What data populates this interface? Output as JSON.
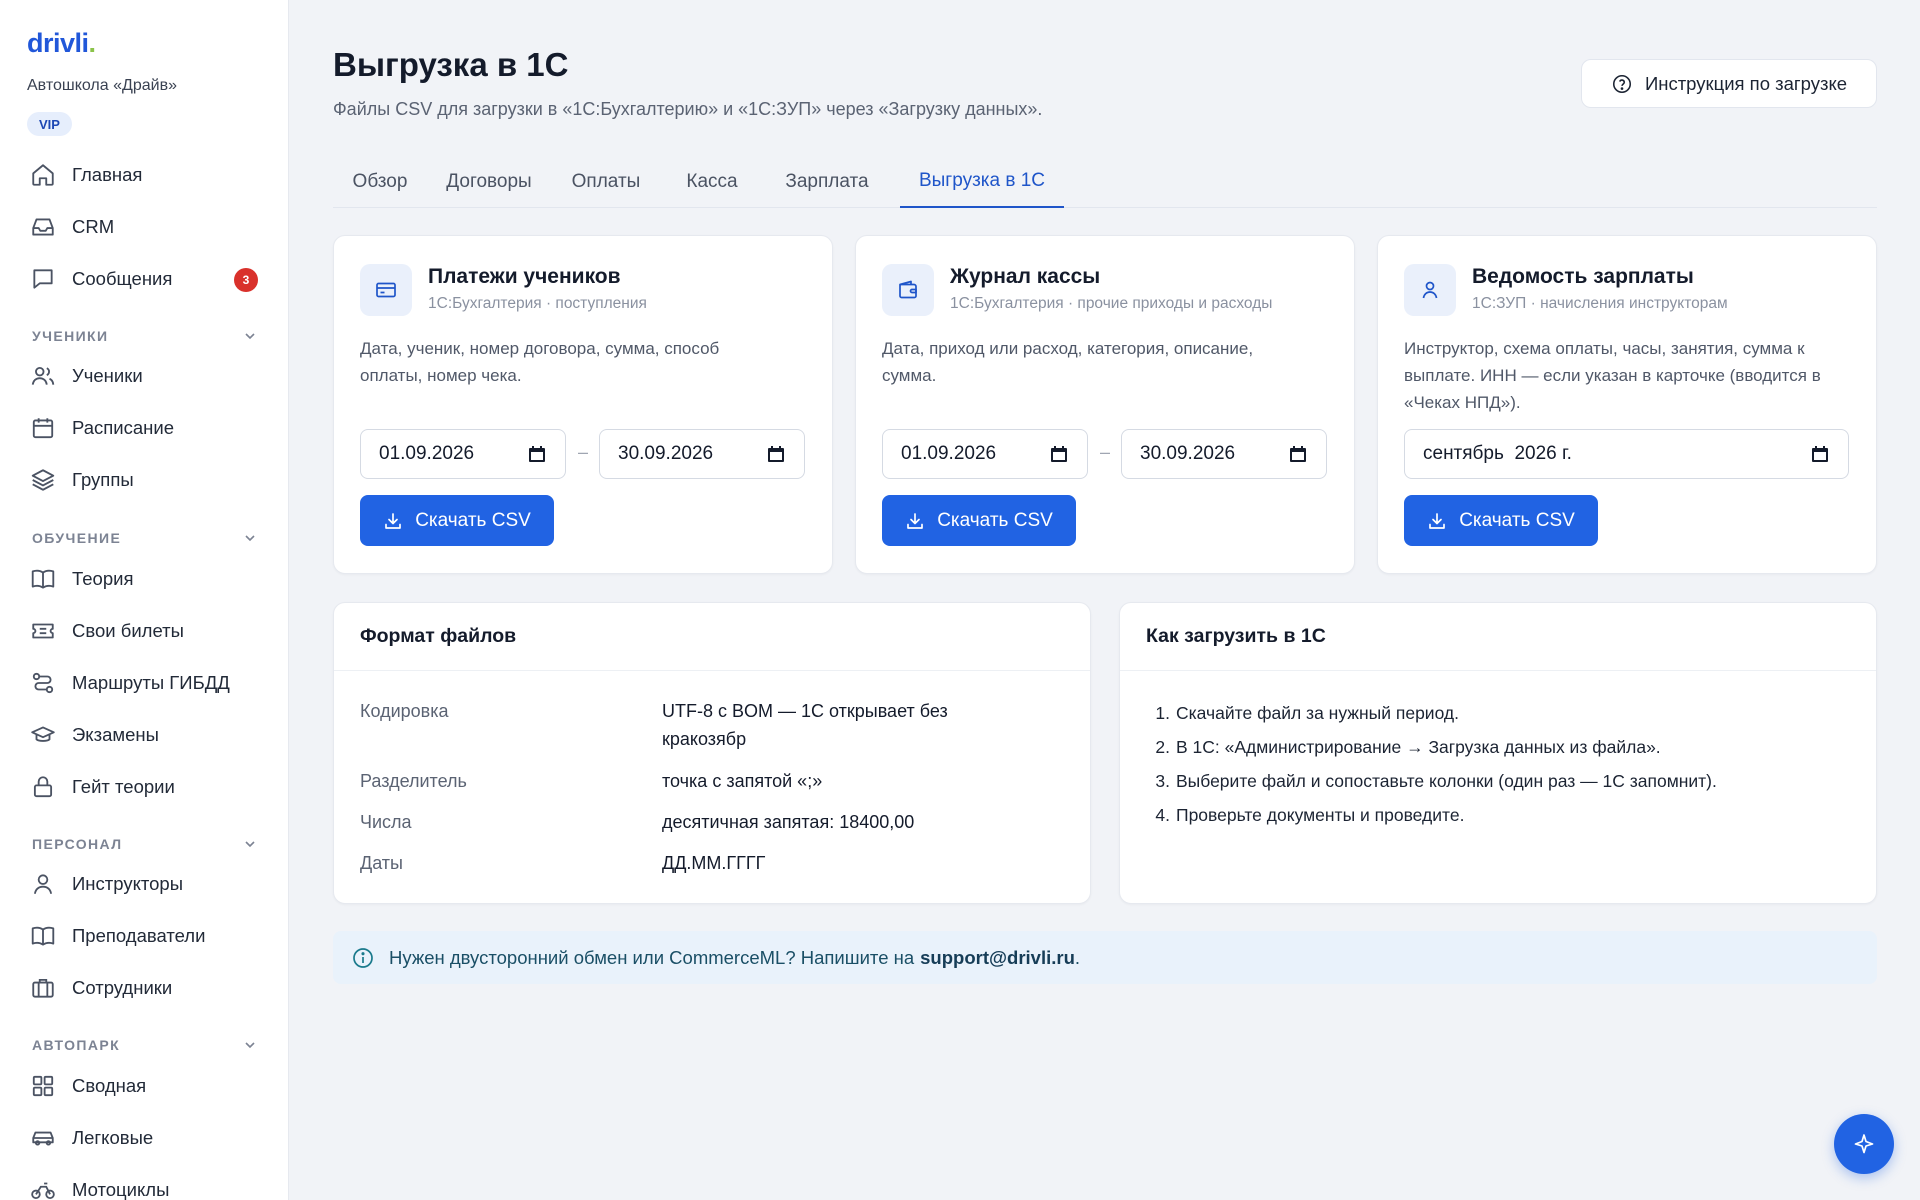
{
  "brand": {
    "logo": "drivli",
    "logo_dot": ".",
    "school": "Автошкола «Драйв»",
    "plan_badge": "VIP"
  },
  "colors": {
    "accent": "#2163e3",
    "badge_red": "#d9312b",
    "logo_green": "#8bc34a",
    "banner_bg": "#e9f2fb"
  },
  "sidebar": {
    "top_items": [
      {
        "label": "Главная",
        "icon": "home-icon"
      },
      {
        "label": "CRM",
        "icon": "inbox-icon"
      },
      {
        "label": "Сообщения",
        "icon": "chat-icon",
        "badge": "3"
      }
    ],
    "sections": [
      {
        "title": "УЧЕНИКИ",
        "items": [
          {
            "label": "Ученики",
            "icon": "users-icon"
          },
          {
            "label": "Расписание",
            "icon": "calendar-icon"
          },
          {
            "label": "Группы",
            "icon": "layers-icon"
          }
        ]
      },
      {
        "title": "ОБУЧЕНИЕ",
        "items": [
          {
            "label": "Теория",
            "icon": "book-icon"
          },
          {
            "label": "Свои билеты",
            "icon": "ticket-icon"
          },
          {
            "label": "Маршруты ГИБДД",
            "icon": "route-icon"
          },
          {
            "label": "Экзамены",
            "icon": "graduation-cap-icon"
          },
          {
            "label": "Гейт теории",
            "icon": "lock-icon"
          }
        ]
      },
      {
        "title": "ПЕРСОНАЛ",
        "items": [
          {
            "label": "Инструкторы",
            "icon": "user-icon"
          },
          {
            "label": "Преподаватели",
            "icon": "book-open-icon"
          },
          {
            "label": "Сотрудники",
            "icon": "briefcase-icon"
          }
        ]
      },
      {
        "title": "АВТОПАРК",
        "items": [
          {
            "label": "Сводная",
            "icon": "grid-icon"
          },
          {
            "label": "Легковые",
            "icon": "car-icon"
          },
          {
            "label": "Мотоциклы",
            "icon": "motorcycle-icon"
          }
        ]
      }
    ]
  },
  "header": {
    "title": "Выгрузка в 1С",
    "subtitle": "Файлы CSV для загрузки в «1С:Бухгалтерию» и «1С:ЗУП» через «Загрузку данных».",
    "help_button": "Инструкция по загрузке"
  },
  "tabs": [
    {
      "label": "Обзор"
    },
    {
      "label": "Договоры"
    },
    {
      "label": "Оплаты"
    },
    {
      "label": "Касса"
    },
    {
      "label": "Зарплата"
    },
    {
      "label": "Выгрузка в 1С",
      "active": true
    }
  ],
  "export_cards": [
    {
      "title": "Платежи учеников",
      "subtitle": "1С:Бухгалтерия · поступления",
      "description": "Дата, ученик, номер договора, сумма, способ оплаты, номер чека.",
      "date_from": "01.09.2026",
      "date_to": "30.09.2026",
      "button": "Скачать CSV"
    },
    {
      "title": "Журнал кассы",
      "subtitle": "1С:Бухгалтерия · прочие приходы и расходы",
      "description": "Дата, приход или расход, категория, описание, сумма.",
      "date_from": "01.09.2026",
      "date_to": "30.09.2026",
      "button": "Скачать CSV"
    },
    {
      "title": "Ведомость зарплаты",
      "subtitle": "1С:ЗУП · начисления инструкторам",
      "description": "Инструктор, схема оплаты, часы, занятия, сумма к выплате. ИНН — если указан в карточке (вводится в «Чеках НПД»).",
      "month": "сентябрь  2026 г.",
      "button": "Скачать CSV"
    }
  ],
  "file_format": {
    "title": "Формат файлов",
    "rows": [
      {
        "key": "Кодировка",
        "value": "UTF-8 с BOM — 1С открывает без кракозябр"
      },
      {
        "key": "Разделитель",
        "value": "точка с запятой «;»"
      },
      {
        "key": "Числа",
        "value": "десятичная запятая: 18400,00"
      },
      {
        "key": "Даты",
        "value": "ДД.ММ.ГГГГ"
      }
    ]
  },
  "how_to": {
    "title": "Как загрузить в 1С",
    "steps": [
      {
        "num": "1.",
        "text": "Скачайте файл за нужный период."
      },
      {
        "num": "2.",
        "text": "В 1С: «Администрирование → Загрузка данных из файла»."
      },
      {
        "num": "3.",
        "text": "Выберите файл и сопоставьте колонки (один раз — 1С запомнит)."
      },
      {
        "num": "4.",
        "text": "Проверьте документы и проведите."
      }
    ]
  },
  "banner": {
    "text": "Нужен двусторонний обмен или CommerceML? Напишите на",
    "email": "support@drivli.ru",
    "tail": "."
  }
}
